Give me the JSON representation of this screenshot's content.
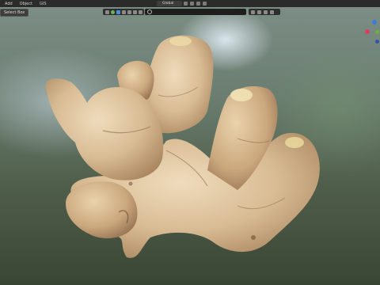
{
  "menu": {
    "items": [
      "Add",
      "Object",
      "GIS"
    ]
  },
  "header": {
    "select_mode": "Select Box",
    "orientation": "Global"
  },
  "colors": {
    "ui_bar": "#2b2b2b",
    "ginger_light": "#e6cfa8",
    "ginger_mid": "#cfae84",
    "ginger_dark": "#8a6a48",
    "gizmo_x": "#d6405a",
    "gizmo_y": "#6cb13d",
    "gizmo_z": "#3f7ad8"
  },
  "icons": [
    "search-icon",
    "cursor-icon",
    "move-icon",
    "snap-icon",
    "filter-icon",
    "view-icon"
  ]
}
